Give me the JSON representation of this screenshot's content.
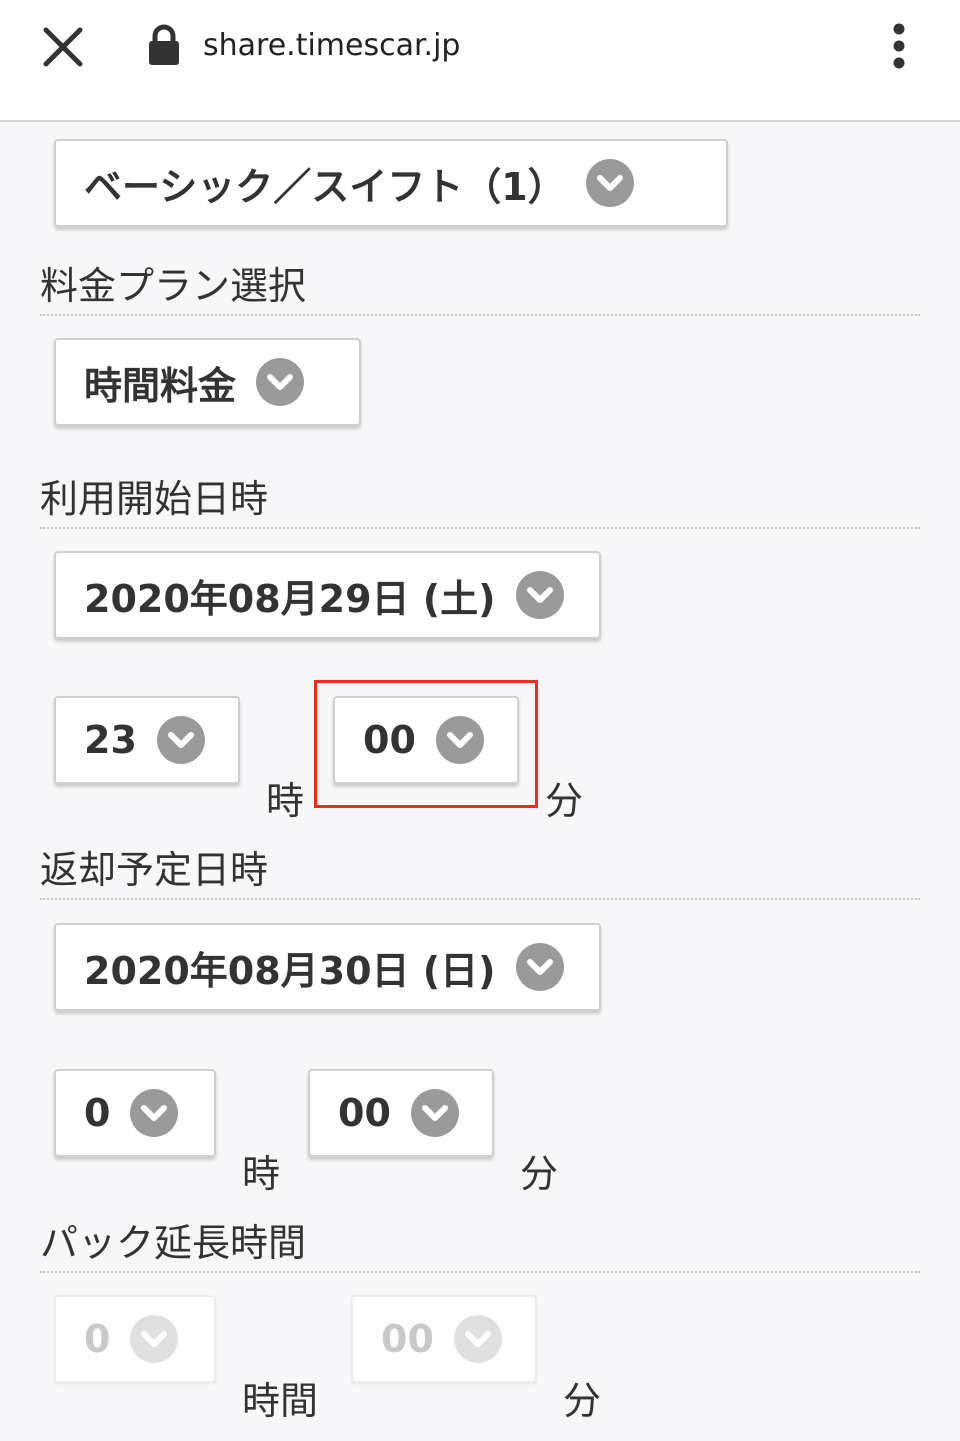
{
  "browser": {
    "url": "share.timescar.jp"
  },
  "car_class": {
    "value": "ベーシック／スイフト（1）"
  },
  "plan": {
    "label": "料金プラン選択",
    "value": "時間料金"
  },
  "start": {
    "label": "利用開始日時",
    "date": "2020年08月29日 (土)",
    "hour": "23",
    "hour_unit": "時",
    "minute": "00",
    "minute_unit": "分"
  },
  "return": {
    "label": "返却予定日時",
    "date": "2020年08月30日 (日)",
    "hour": "0",
    "hour_unit": "時",
    "minute": "00",
    "minute_unit": "分"
  },
  "pack": {
    "label": "パック延長時間",
    "hours": "0",
    "hours_unit": "時間",
    "minutes": "00",
    "minutes_unit": "分"
  },
  "colors": {
    "highlight": "#e8301c",
    "chevron": "#9a9a9a",
    "chevron_disabled": "#e0e0e0"
  },
  "icons": [
    "close-icon",
    "lock-icon",
    "more-vert-icon",
    "chevron-down-icon"
  ]
}
